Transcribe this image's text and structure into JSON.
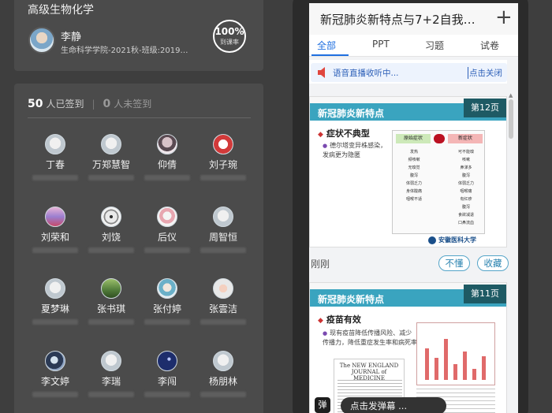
{
  "course": {
    "title": "高级生物化学",
    "teacher_name": "李静",
    "teacher_info": "生命科学学院-2021秋-班级:2019级...",
    "attendance_value": "100%",
    "attendance_label": "到课率"
  },
  "signin": {
    "signed_count": "50",
    "signed_label": "人已签到",
    "separator": "|",
    "unsigned_count": "0",
    "unsigned_label": "人未签到",
    "students": [
      {
        "name": "丁春"
      },
      {
        "name": "万郑慧智"
      },
      {
        "name": "仰倩"
      },
      {
        "name": "刘子琬"
      },
      {
        "name": "刘荣和"
      },
      {
        "name": "刘饶"
      },
      {
        "name": "后仪"
      },
      {
        "name": "周智恒"
      },
      {
        "name": "夏梦琳"
      },
      {
        "name": "张书琪"
      },
      {
        "name": "张付婷"
      },
      {
        "name": "张雲洁"
      },
      {
        "name": "李文婷"
      },
      {
        "name": "李瑞"
      },
      {
        "name": "李闯"
      },
      {
        "name": "杨朋林"
      }
    ]
  },
  "phone": {
    "title": "新冠肺炎新特点与7+2自我健...",
    "plus": "+",
    "tabs": [
      "全部",
      "PPT",
      "习题",
      "试卷"
    ],
    "notice_text": "语音直播收听中...",
    "notice_close": "点击关闭",
    "slide1": {
      "heading": "新冠肺炎新特点",
      "page": "第12页",
      "bullet": "症状不典型",
      "sub_bullet": "德尔塔变异株感染，发病更为隐匿",
      "table_left_header": "原始症状",
      "table_right_header": "新症状",
      "left_symptoms": [
        "发热",
        "频咳嗽",
        "无嗅觉",
        "腹泻",
        "体弱乏力",
        "身体酸痛",
        "咽喉不适"
      ],
      "right_symptoms": [
        "可不能嗅",
        "咳嗽",
        "鼻涕多",
        "腹泻",
        "体弱乏力",
        "咽喉痛",
        "有红疹",
        "腹泻",
        "食欲减退",
        "口鼻流血"
      ],
      "university": "安徽医科大学"
    },
    "meta": {
      "time": "刚刚",
      "btn_dont_understand": "不懂",
      "btn_favorite": "收藏"
    },
    "slide2": {
      "heading": "新冠肺炎新特点",
      "page": "第11页",
      "bullet": "疫苗有效",
      "sub_bullet": "现有疫苗降低传播风险、减少传播力，降低重症发生率和病死率",
      "journal_title": "The NEW ENGLAND JOURNAL of MEDICINE"
    },
    "danmu_button": "弹",
    "danmu_placeholder": "点击发弹幕 ..."
  }
}
